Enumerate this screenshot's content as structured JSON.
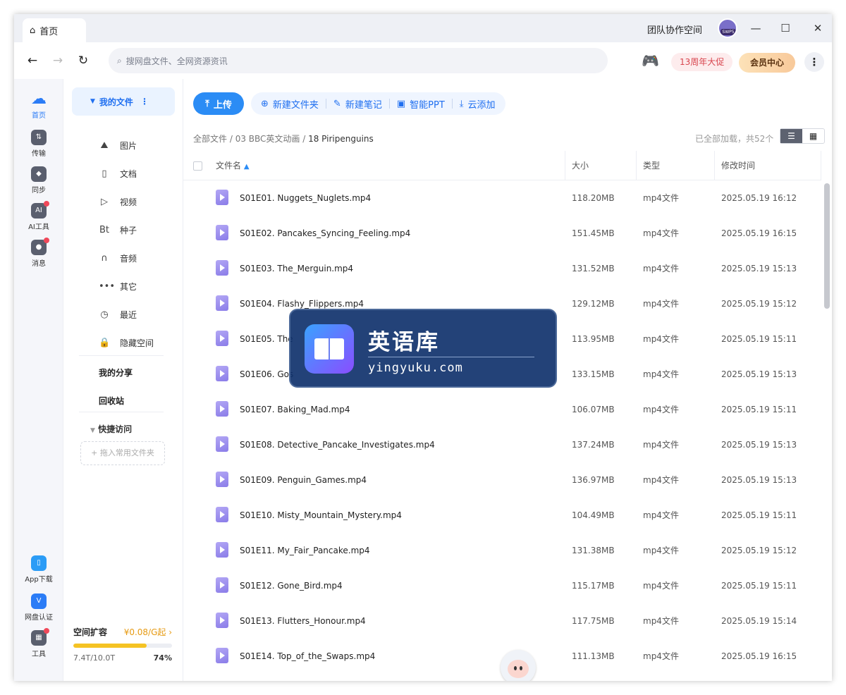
{
  "titlebar": {
    "tab_label": "首页",
    "team_space": "团队协作空间",
    "avatar_badge": "SWP5"
  },
  "navbar": {
    "search_placeholder": "搜网盘文件、全网资源资讯",
    "anniversary": "13周年大促",
    "vip": "会员中心"
  },
  "rail": [
    {
      "label": "首页",
      "icon": "cloud-logo-icon",
      "active": true
    },
    {
      "label": "传输",
      "icon": "transfer-icon",
      "badge": false
    },
    {
      "label": "同步",
      "icon": "sync-icon",
      "badge": false
    },
    {
      "label": "AI工具",
      "icon": "ai-tools-icon",
      "badge": true
    },
    {
      "label": "消息",
      "icon": "message-icon",
      "badge": true
    },
    {
      "label": "App下载",
      "icon": "phone-icon",
      "badge": false
    },
    {
      "label": "网盘认证",
      "icon": "verify-icon",
      "badge": false
    },
    {
      "label": "工具",
      "icon": "tools-grid-icon",
      "badge": true
    }
  ],
  "sidebar": {
    "my_files": "我的文件",
    "items": [
      {
        "label": "图片",
        "icon": "image-icon",
        "glyph": "⛰"
      },
      {
        "label": "文档",
        "icon": "document-icon",
        "glyph": "▯"
      },
      {
        "label": "视频",
        "icon": "video-icon",
        "glyph": "▷"
      },
      {
        "label": "种子",
        "icon": "torrent-icon",
        "glyph": "Bt"
      },
      {
        "label": "音频",
        "icon": "headphones-icon",
        "glyph": "∩"
      },
      {
        "label": "其它",
        "icon": "more-dots-icon",
        "glyph": "•••"
      },
      {
        "label": "最近",
        "icon": "history-icon",
        "glyph": "◷"
      },
      {
        "label": "隐藏空间",
        "icon": "lock-icon",
        "glyph": "🔒"
      }
    ],
    "my_share": "我的分享",
    "recycle": "回收站",
    "quick_access": "快捷访问",
    "drop_hint": "+ 拖入常用文件夹",
    "quota": {
      "title": "空间扩容",
      "price": "¥0.08/G起 ›",
      "used": "7.4T/10.0T",
      "percent_label": "74%",
      "fraction": 0.74
    }
  },
  "toolbar": {
    "upload": "上传",
    "actions": [
      {
        "label": "新建文件夹",
        "icon": "new-folder-icon",
        "glyph": "⊕"
      },
      {
        "label": "新建笔记",
        "icon": "new-note-icon",
        "glyph": "✎"
      },
      {
        "label": "智能PPT",
        "icon": "smart-ppt-icon",
        "glyph": "▣"
      },
      {
        "label": "云添加",
        "icon": "cloud-add-icon",
        "glyph": "⤓"
      }
    ]
  },
  "breadcrumb": {
    "root": "全部文件",
    "sep1": " / ",
    "mid": "03 BBC英文动画",
    "sep2": " / ",
    "current": "18 Piripenguins"
  },
  "loaded_status": "已全部加载，共52个",
  "columns": {
    "name": "文件名",
    "size": "大小",
    "type": "类型",
    "modified": "修改时间"
  },
  "files": [
    {
      "name": "S01E01. Nuggets_Nuglets.mp4",
      "size": "118.20MB",
      "type": "mp4文件",
      "modified": "2025.05.19 16:12"
    },
    {
      "name": "S01E02. Pancakes_Syncing_Feeling.mp4",
      "size": "151.45MB",
      "type": "mp4文件",
      "modified": "2025.05.19 16:15"
    },
    {
      "name": "S01E03. The_Merguin.mp4",
      "size": "131.52MB",
      "type": "mp4文件",
      "modified": "2025.05.19 15:13"
    },
    {
      "name": "S01E04. Flashy_Flippers.mp4",
      "size": "129.12MB",
      "type": "mp4文件",
      "modified": "2025.05.19 15:12"
    },
    {
      "name": "S01E05. The",
      "size": "113.95MB",
      "type": "mp4文件",
      "modified": "2025.05.19 15:11"
    },
    {
      "name": "S01E06. Gos",
      "size": "133.15MB",
      "type": "mp4文件",
      "modified": "2025.05.19 15:13"
    },
    {
      "name": "S01E07. Baking_Mad.mp4",
      "size": "106.07MB",
      "type": "mp4文件",
      "modified": "2025.05.19 15:11"
    },
    {
      "name": "S01E08. Detective_Pancake_Investigates.mp4",
      "size": "137.24MB",
      "type": "mp4文件",
      "modified": "2025.05.19 15:13"
    },
    {
      "name": "S01E09. Penguin_Games.mp4",
      "size": "136.97MB",
      "type": "mp4文件",
      "modified": "2025.05.19 15:13"
    },
    {
      "name": "S01E10. Misty_Mountain_Mystery.mp4",
      "size": "104.49MB",
      "type": "mp4文件",
      "modified": "2025.05.19 15:11"
    },
    {
      "name": "S01E11. My_Fair_Pancake.mp4",
      "size": "131.38MB",
      "type": "mp4文件",
      "modified": "2025.05.19 15:12"
    },
    {
      "name": "S01E12. Gone_Bird.mp4",
      "size": "115.17MB",
      "type": "mp4文件",
      "modified": "2025.05.19 15:11"
    },
    {
      "name": "S01E13. Flutters_Honour.mp4",
      "size": "117.75MB",
      "type": "mp4文件",
      "modified": "2025.05.19 15:14"
    },
    {
      "name": "S01E14. Top_of_the_Swaps.mp4",
      "size": "111.13MB",
      "type": "mp4文件",
      "modified": "2025.05.19 16:15"
    }
  ],
  "watermark": {
    "title": "英语库",
    "url": "yingyuku.com"
  }
}
